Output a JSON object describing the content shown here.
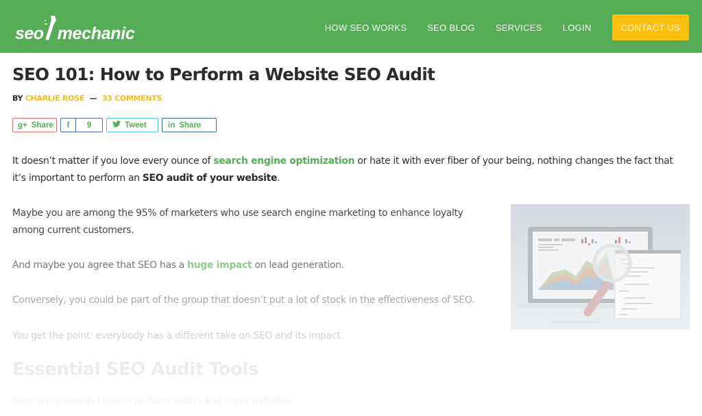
{
  "header": {
    "logo": {
      "part1": "seo",
      "part2": "mechanic",
      "icon": "wrench-icon"
    },
    "nav": [
      {
        "label": "HOW SEO WORKS"
      },
      {
        "label": "SEO BLOG"
      },
      {
        "label": "SERVICES"
      },
      {
        "label": "LOGIN"
      }
    ],
    "cta": {
      "label": "CONTACT US"
    },
    "colors": {
      "background": "#55ae55",
      "cta": "#fdc00f"
    }
  },
  "article": {
    "title": "SEO 101: How to Perform a Website SEO Audit",
    "byline": {
      "by": "BY",
      "author": "CHARLIE ROSE",
      "separator": "—",
      "comments": "33 COMMENTS"
    },
    "share": {
      "gplus": {
        "icon": "google-plus-icon",
        "glyph": "g+",
        "label": "Share"
      },
      "facebook": {
        "icon": "facebook-icon",
        "glyph": "f",
        "count": "9"
      },
      "twitter": {
        "icon": "twitter-icon",
        "glyph": "🐦",
        "label": "Tweet"
      },
      "linkedin": {
        "icon": "linkedin-icon",
        "glyph": "in",
        "label": "Share"
      }
    },
    "paragraphs": {
      "p1": {
        "pre": "It doesn’t matter if you love every ounce of ",
        "link": "search engine optimization",
        "mid": " or hate it with ever fiber of your being, nothing changes the fact that",
        "line2_pre": "it’s important to perform an ",
        "bold": "SEO audit of your website",
        "end": "."
      },
      "p2": {
        "line1": "Maybe you are among the 95% of marketers who use search engine marketing to enhance loyalty",
        "line2": "among current customers."
      },
      "p3": {
        "pre": "And maybe you agree that SEO has a ",
        "link": "huge impact",
        "post": " on lead generation."
      },
      "p4": "Conversely, you could be part of the group that doesn’t put a lot of stock in the effectiveness of SEO.",
      "p5": "You get the point: everybody has a different take on SEO and its impact.",
      "h2": "Essential SEO Audit Tools",
      "p6": "Here are the tools I use to perform audits and crawl websites."
    },
    "image": {
      "alt": "SEO audit illustration: laptop with analytics chart and magnifying glass over code"
    }
  }
}
